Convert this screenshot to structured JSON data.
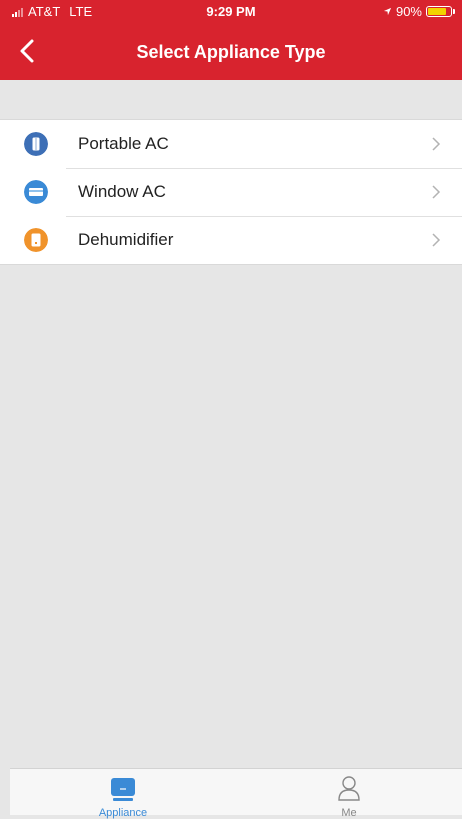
{
  "status_bar": {
    "carrier": "AT&T",
    "network": "LTE",
    "time": "9:29 PM",
    "battery": "90%"
  },
  "header": {
    "title": "Select Appliance Type",
    "back_icon": "chevron-left-icon"
  },
  "appliances": [
    {
      "label": "Portable AC",
      "icon": "portable-ac-icon",
      "color": "#3d6fb6"
    },
    {
      "label": "Window AC",
      "icon": "window-ac-icon",
      "color": "#3a8ad6"
    },
    {
      "label": "Dehumidifier",
      "icon": "dehumidifier-icon",
      "color": "#f0932b"
    }
  ],
  "tabbar": {
    "tabs": [
      {
        "label": "Appliance",
        "icon": "appliance-icon",
        "active": true
      },
      {
        "label": "Me",
        "icon": "person-icon",
        "active": false
      }
    ]
  },
  "colors": {
    "brand": "#d8232e",
    "active_tab": "#3a8ad6",
    "inactive_tab": "#888888"
  }
}
